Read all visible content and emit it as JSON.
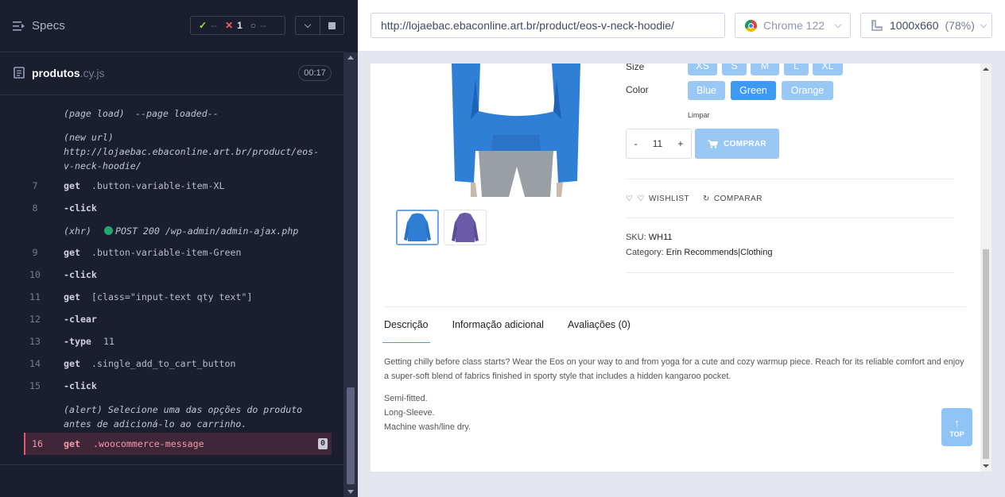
{
  "runner": {
    "specs_label": "Specs",
    "stats": {
      "passed": "--",
      "failed": "1",
      "pending": "--"
    },
    "spec_file": {
      "name": "produtos",
      "ext": ".cy.js",
      "duration": "00:17"
    },
    "commands": [
      {
        "num": "",
        "name": "(page load)",
        "message": "--page loaded--",
        "italic": true
      },
      {
        "num": "",
        "name": "(new url)",
        "message": "http://lojaebac.ebaconline.art.br/product/eos-v-neck-hoodie/",
        "italic": true
      },
      {
        "num": "7",
        "name": "get",
        "message": ".button-variable-item-XL"
      },
      {
        "num": "8",
        "name": "-click",
        "message": ""
      },
      {
        "num": "",
        "name": "(xhr)",
        "message": "POST 200 /wp-admin/admin-ajax.php",
        "italic": true
      },
      {
        "num": "9",
        "name": "get",
        "message": ".button-variable-item-Green"
      },
      {
        "num": "10",
        "name": "-click",
        "message": ""
      },
      {
        "num": "11",
        "name": "get",
        "message": "[class=\"input-text qty text\"]"
      },
      {
        "num": "12",
        "name": "-clear",
        "message": ""
      },
      {
        "num": "13",
        "name": "-type",
        "message": "11"
      },
      {
        "num": "14",
        "name": "get",
        "message": ".single_add_to_cart_button"
      },
      {
        "num": "15",
        "name": "-click",
        "message": ""
      },
      {
        "num": "",
        "name": "(alert)",
        "message": "Selecione uma das opções do produto antes de adicioná-lo ao carrinho.",
        "italic": true
      },
      {
        "num": "16",
        "name": "get",
        "message": ".woocommerce-message",
        "badge": "0",
        "failed": true
      }
    ]
  },
  "aut": {
    "url": "http://lojaebac.ebaconline.art.br/product/eos-v-neck-hoodie/",
    "browser": "Chrome 122",
    "viewport": "1000x660",
    "zoom": "(78%)"
  },
  "product": {
    "size_label": "Size",
    "sizes": [
      "XS",
      "S",
      "M",
      "L",
      "XL"
    ],
    "color_label": "Color",
    "colors": [
      "Blue",
      "Green",
      "Orange"
    ],
    "selected_color": "Green",
    "clear_label": "Limpar",
    "qty_minus": "-",
    "qty_value": "11",
    "qty_plus": "+",
    "buy_label": "COMPRAR",
    "wishlist_label": "WISHLIST",
    "compare_label": "COMPARAR",
    "sku_label": "SKU:",
    "sku_value": "WH11",
    "category_label": "Category:",
    "category_value": "Erin Recommends|Clothing",
    "tabs": [
      "Descrição",
      "Informação adicional",
      "Avaliações (0)"
    ],
    "description": "Getting chilly before class starts? Wear the Eos on your way to and from yoga for a cute and cozy warmup piece. Reach for its reliable comfort and enjoy a super-soft blend of fabrics finished in sporty style that includes a hidden kangaroo pocket.",
    "features": [
      "Semi-fitted.",
      "Long-Sleeve.",
      "Machine wash/line dry."
    ],
    "top_label": "TOP"
  },
  "colors": {
    "accent_blue": "#3d9af3",
    "light_blue": "#99c8f4",
    "fail_red": "#f15e6e",
    "pass_green": "#a3e635"
  }
}
